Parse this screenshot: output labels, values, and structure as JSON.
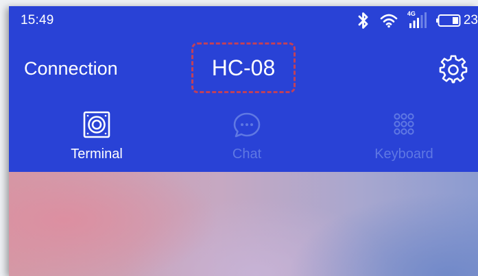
{
  "status_bar": {
    "time": "15:49",
    "network_label": "4G",
    "battery_percent": "23"
  },
  "header": {
    "connection_label": "Connection",
    "device_name": "HC-08",
    "highlight_color": "#c0405a"
  },
  "tabs": [
    {
      "label": "Terminal",
      "icon": "terminal-icon",
      "active": true
    },
    {
      "label": "Chat",
      "icon": "chat-icon",
      "active": false
    },
    {
      "label": "Keyboard",
      "icon": "keyboard-icon",
      "active": false
    }
  ],
  "colors": {
    "accent": "#2942d6",
    "tab_inactive": "#5f78e3"
  }
}
